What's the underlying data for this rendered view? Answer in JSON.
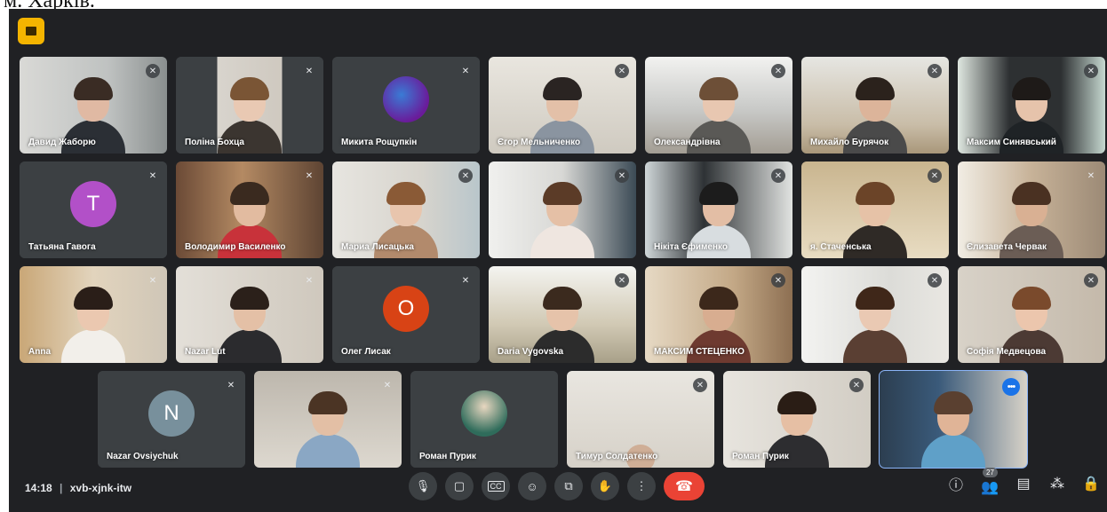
{
  "page_top_text": "м. Харків.",
  "meeting": {
    "time": "14:18",
    "separator": "|",
    "code": "xvb-xjnk-itw",
    "participants_count": "27"
  },
  "icons": {
    "mic": "mic-icon",
    "camera": "camera-icon",
    "captions": "captions-icon",
    "emoji": "emoji-icon",
    "present": "present-icon",
    "hand": "raise-hand-icon",
    "more": "more-options-icon",
    "end_call": "end-call-icon",
    "info": "info-icon",
    "people": "people-icon",
    "chat": "chat-icon",
    "activities": "activities-icon",
    "lock": "host-controls-icon"
  },
  "colors": {
    "background": "#202124",
    "end_call": "#ea4335",
    "active_speaker": "#8ab4f8"
  },
  "participants": [
    {
      "name": "Давид Жаборю",
      "avatar_letter": "",
      "avatar_color": ""
    },
    {
      "name": "Поліна Бохца",
      "avatar_letter": "",
      "avatar_color": ""
    },
    {
      "name": "Микита Рощупкін",
      "avatar_letter": "",
      "avatar_color": "#5e2ca5"
    },
    {
      "name": "Єгор Мельниченко",
      "avatar_letter": "",
      "avatar_color": ""
    },
    {
      "name": "Олександрівна",
      "avatar_letter": "",
      "avatar_color": ""
    },
    {
      "name": "Михайло Бурячок",
      "avatar_letter": "",
      "avatar_color": ""
    },
    {
      "name": "Максим Синявський",
      "avatar_letter": "",
      "avatar_color": ""
    },
    {
      "name": "Татьяна Гавога",
      "avatar_letter": "T",
      "avatar_color": "#b250c8"
    },
    {
      "name": "Володимир Василенко",
      "avatar_letter": "",
      "avatar_color": ""
    },
    {
      "name": "Мариа Лисацька",
      "avatar_letter": "",
      "avatar_color": ""
    },
    {
      "name": "",
      "avatar_letter": "",
      "avatar_color": ""
    },
    {
      "name": "Нікіта Єфименко",
      "avatar_letter": "",
      "avatar_color": ""
    },
    {
      "name": "я. Стаченська",
      "avatar_letter": "",
      "avatar_color": ""
    },
    {
      "name": "Єлизавета Червак",
      "avatar_letter": "",
      "avatar_color": ""
    },
    {
      "name": "Anna",
      "avatar_letter": "",
      "avatar_color": ""
    },
    {
      "name": "Nazar Lut",
      "avatar_letter": "",
      "avatar_color": ""
    },
    {
      "name": "Олег Лисак",
      "avatar_letter": "O",
      "avatar_color": "#d84315"
    },
    {
      "name": "Daria Vygovska",
      "avatar_letter": "",
      "avatar_color": ""
    },
    {
      "name": "МАКСИМ СТЕЦЕНКО",
      "avatar_letter": "",
      "avatar_color": ""
    },
    {
      "name": "",
      "avatar_letter": "",
      "avatar_color": ""
    },
    {
      "name": "Софія Медвецова",
      "avatar_letter": "",
      "avatar_color": ""
    },
    {
      "name": "Nazar Ovsiychuk",
      "avatar_letter": "N",
      "avatar_color": "#78909c"
    },
    {
      "name": "",
      "avatar_letter": "",
      "avatar_color": ""
    },
    {
      "name": "Роман Пурик",
      "avatar_letter": "",
      "avatar_color": ""
    },
    {
      "name": "Тимур Солдатенко",
      "avatar_letter": "",
      "avatar_color": ""
    },
    {
      "name": "Роман Пурик",
      "avatar_letter": "",
      "avatar_color": ""
    },
    {
      "name": "",
      "avatar_letter": "",
      "avatar_color": ""
    }
  ]
}
